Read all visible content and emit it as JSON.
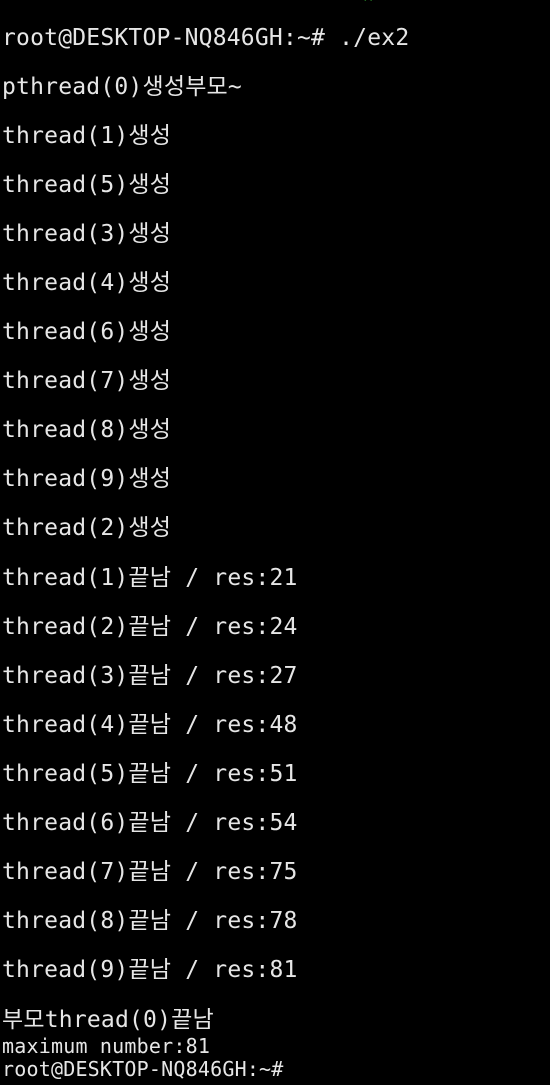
{
  "terminal": {
    "caret": "^",
    "lines": [
      "root@DESKTOP-NQ846GH:~# ./ex2",
      "pthread(0)생성부모~",
      "thread(1)생성",
      "thread(5)생성",
      "thread(3)생성",
      "thread(4)생성",
      "thread(6)생성",
      "thread(7)생성",
      "thread(8)생성",
      "thread(9)생성",
      "thread(2)생성",
      "thread(1)끝남 / res:21",
      "thread(2)끝남 / res:24",
      "thread(3)끝남 / res:27",
      "thread(4)끝남 / res:48",
      "thread(5)끝남 / res:51",
      "thread(6)끝남 / res:54",
      "thread(7)끝남 / res:75",
      "thread(8)끝남 / res:78",
      "thread(9)끝남 / res:81",
      "부모thread(0)끝남",
      "maximum number:81",
      "root@DESKTOP-NQ846GH:~#"
    ]
  },
  "colors": {
    "background": "#000000",
    "text": "#e6e6e6",
    "caret": "#3fd13f"
  }
}
